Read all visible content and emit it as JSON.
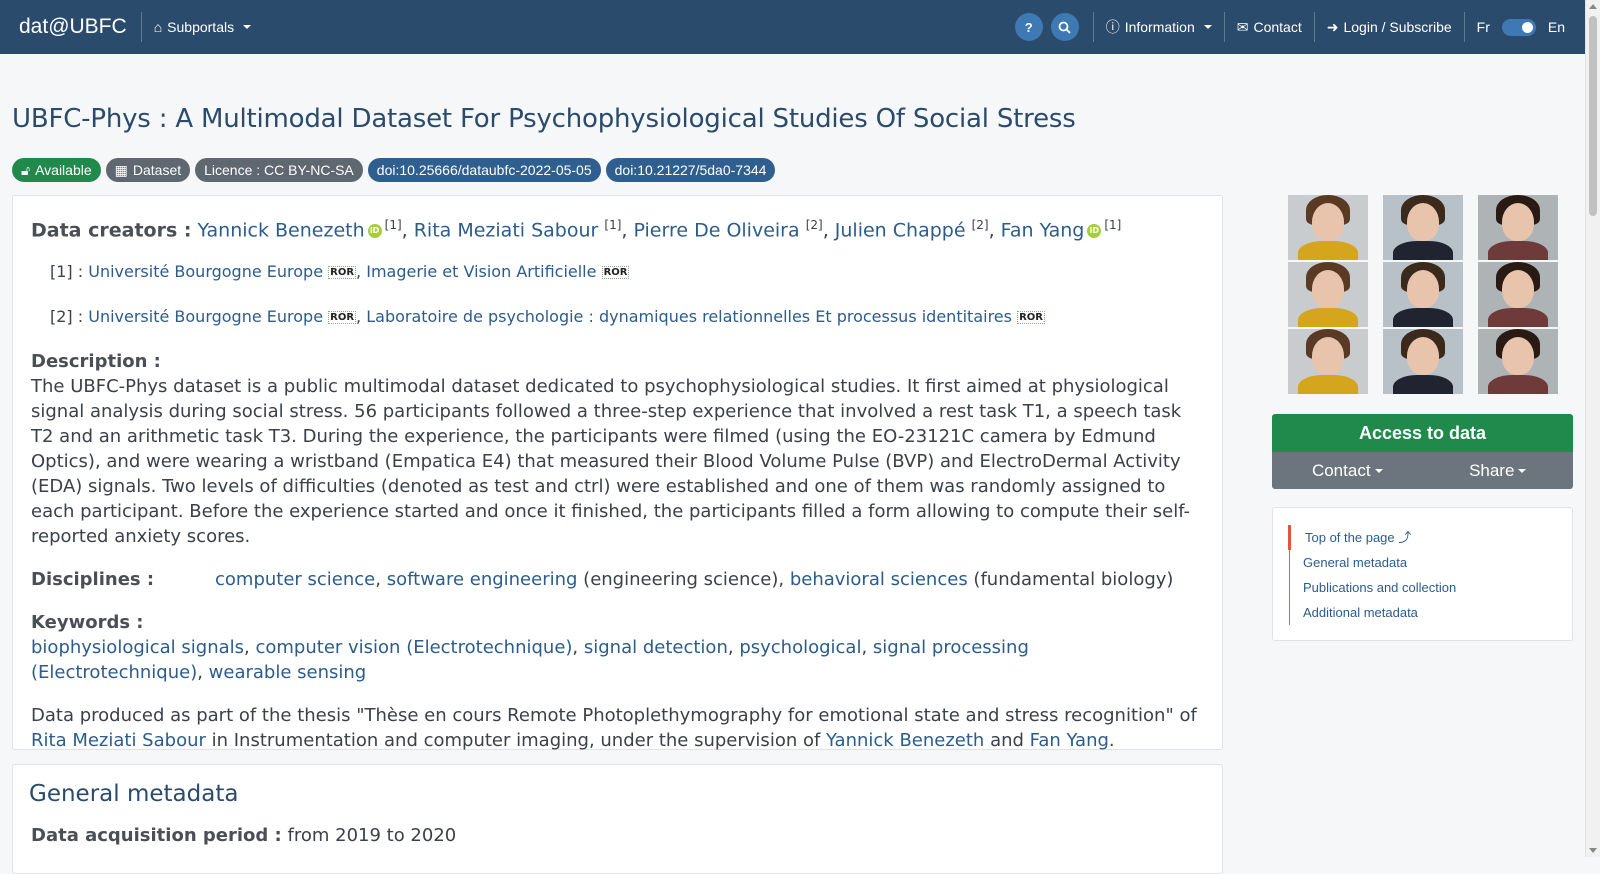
{
  "navbar": {
    "brand": "dat@UBFC",
    "subportals": "Subportals",
    "help_icon": "?",
    "information": "Information",
    "contact": "Contact",
    "login": "Login / Subscribe",
    "lang_fr": "Fr",
    "lang_en": "En"
  },
  "page": {
    "title": "UBFC-Phys : A Multimodal Dataset For Psychophysiological Studies Of Social Stress",
    "badges": {
      "available": "Available",
      "dataset": "Dataset",
      "licence": "Licence : CC BY-NC-SA",
      "doi1": "doi:10.25666/dataubfc-2022-05-05",
      "doi2": "doi:10.21227/5da0-7344"
    }
  },
  "creators": {
    "label": "Data creators :",
    "people": [
      {
        "name": "Yannick Benezeth",
        "ref": "[1]"
      },
      {
        "name": "Rita Meziati Sabour",
        "ref": "[1]"
      },
      {
        "name": "Pierre De Oliveira",
        "ref": "[2]"
      },
      {
        "name": "Julien Chappé",
        "ref": "[2]"
      },
      {
        "name": "Fan Yang",
        "ref": "[1]"
      }
    ],
    "affiliations": [
      {
        "ref": "[1] :",
        "orgs": [
          "Université Bourgogne Europe",
          "Imagerie et Vision Artificielle"
        ]
      },
      {
        "ref": "[2] :",
        "orgs": [
          "Université Bourgogne Europe",
          "Laboratoire de psychologie : dynamiques relationnelles Et processus identitaires"
        ]
      }
    ],
    "ror": "ROR",
    "orcid": "iD"
  },
  "description": {
    "label": "Description :",
    "text": "The UBFC-Phys dataset is a public multimodal dataset dedicated to psychophysiological studies. It first aimed at physiological signal analysis during social stress. 56 participants followed a three-step experience that involved a rest task T1, a speech task T2 and an arithmetic task T3. During the experience, the participants were filmed (using the EO-23121C camera by Edmund Optics), and were wearing a wristband (Empatica E4) that measured their Blood Volume Pulse (BVP) and ElectroDermal Activity (EDA) signals. Two levels of difficulties (denoted as test and ctrl) were established and one of them was randomly assigned to each participant. Before the experience started and once it finished, the participants filled a form allowing to compute their self-reported anxiety scores."
  },
  "disciplines": {
    "label": "Disciplines :",
    "items": [
      {
        "link": "computer science",
        "sep": ", "
      },
      {
        "link": "software engineering",
        "suffix": " (engineering science), "
      },
      {
        "link": "behavioral sciences",
        "suffix": " (fundamental biology)"
      }
    ]
  },
  "keywords": {
    "label": "Keywords :",
    "items": [
      "biophysiological signals",
      "computer vision (Electrotechnique)",
      "signal detection",
      "psychological",
      "signal processing (Electrotechnique)",
      "wearable sensing"
    ]
  },
  "thesis": {
    "prefix": "Data produced as part of the thesis \"Thèse en cours Remote Photoplethymography for emotional state and stress recognition\" of ",
    "author": "Rita Meziati Sabour",
    "middle": " in Instrumentation and computer imaging, under the supervision of ",
    "sup1": "Yannick Benezeth",
    "and": " and ",
    "sup2": "Fan Yang",
    "end": "."
  },
  "general_metadata": {
    "title": "General metadata",
    "acq_label": "Data acquisition period :",
    "acq_value": "from 2019 to 2020"
  },
  "sidebar": {
    "access": "Access to data",
    "contact": "Contact",
    "share": "Share",
    "toc": [
      "Top of the page ⤴",
      "General metadata",
      "Publications and collection",
      "Additional metadata"
    ]
  },
  "colors": {
    "navbar": "#2b4b6c",
    "access": "#1f8a4c",
    "link": "#2c5c8c"
  }
}
